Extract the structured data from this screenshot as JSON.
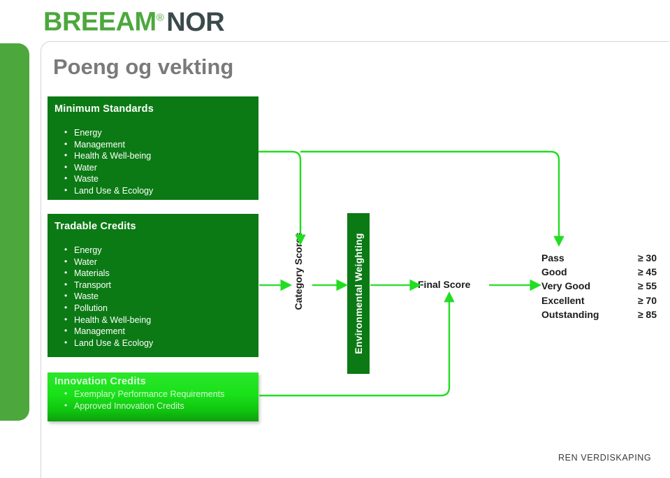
{
  "logo": {
    "primary": "BREEAM",
    "registered": "®",
    "secondary": "NOR",
    "primary_color": "#4CA83C",
    "secondary_color": "#3B4A4B"
  },
  "page_title": "Poeng og vekting",
  "title_color": "#7a7a7a",
  "colors": {
    "dark_green": "#0B7A14",
    "medium_green": "#4CA83C",
    "bright_green": "#1FE01F",
    "arrow_green": "#22DD22",
    "frame_gray": "#d4d4d4"
  },
  "boxes": {
    "minimum_standards": {
      "title": "Minimum Standards",
      "items": [
        "Energy",
        "Management",
        "Health & Well-being",
        "Water",
        "Waste",
        "Land Use & Ecology"
      ]
    },
    "tradable_credits": {
      "title": "Tradable Credits",
      "items": [
        "Energy",
        "Water",
        "Materials",
        "Transport",
        "Waste",
        "Pollution",
        "Health & Well-being",
        "Management",
        "Land Use & Ecology"
      ]
    },
    "innovation_credits": {
      "title": "Innovation Credits",
      "items": [
        "Exemplary Performance Requirements",
        "Approved Innovation Credits"
      ]
    }
  },
  "flow": {
    "category_scores_label": "Category Scores",
    "environmental_weighting_label": "Environmental Weighting",
    "final_score_label": "Final Score"
  },
  "ratings": {
    "rows": [
      {
        "label": "Pass",
        "score": "≥ 30"
      },
      {
        "label": "Good",
        "score": "≥ 45"
      },
      {
        "label": "Very Good",
        "score": "≥ 55"
      },
      {
        "label": "Excellent",
        "score": "≥ 70"
      },
      {
        "label": "Outstanding",
        "score": "≥ 85"
      }
    ]
  },
  "footer": "REN VERDISKAPING"
}
